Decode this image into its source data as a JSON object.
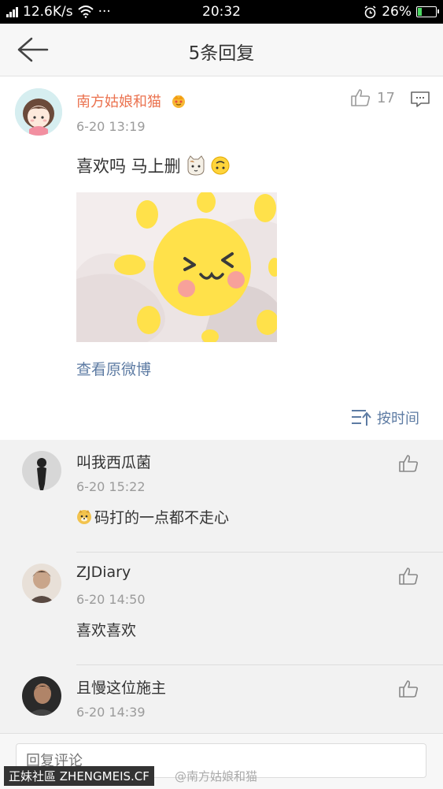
{
  "status_bar": {
    "network_speed": "12.6K/s",
    "dots": "···",
    "time": "20:32",
    "battery": "26%",
    "battery_level": 0.26,
    "alarm_icon": "alarm-icon",
    "wifi_icon": "wifi-icon"
  },
  "nav": {
    "title": "5条回复",
    "back_icon": "back-arrow-icon"
  },
  "main_comment": {
    "username": "南方姑娘和猫",
    "time": "6-20 13:19",
    "likes": "17",
    "text": "喜欢吗  马上删",
    "view_original": "查看原微博",
    "sort_label": "按时间",
    "colors": {
      "username": "#eb7350",
      "link": "#5d7ba3"
    }
  },
  "replies": [
    {
      "name": "叫我西瓜菌",
      "time": "6-20 15:22",
      "text": "码打的一点都不走心"
    },
    {
      "name": "ZJDiary",
      "time": "6-20 14:50",
      "text": "喜欢喜欢"
    },
    {
      "name": "且慢这位施主",
      "time": "6-20 14:39",
      "text": ""
    }
  ],
  "bottom": {
    "placeholder": "回复评论"
  },
  "watermarks": {
    "left": "正妹社區 ZHENGMEIS.CF",
    "right": "@南方姑娘和猫"
  }
}
